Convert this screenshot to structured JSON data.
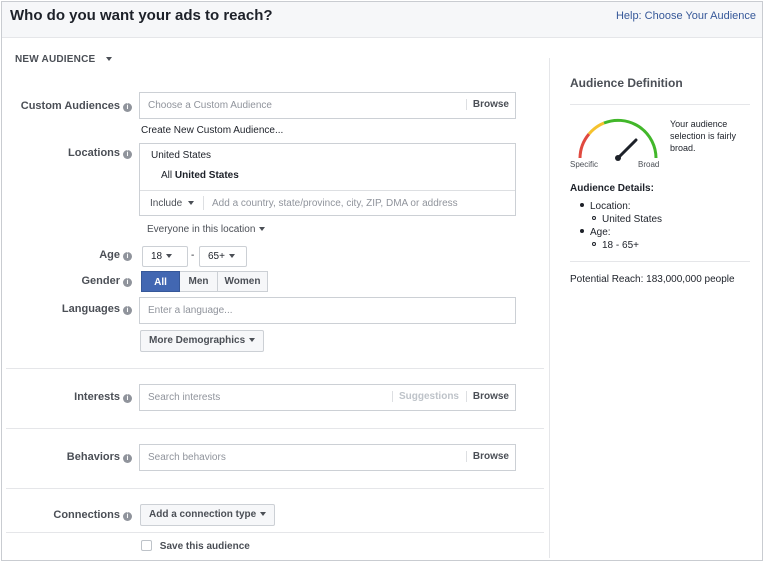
{
  "header": {
    "title": "Who do you want your ads to reach?",
    "help": "Help: Choose Your Audience"
  },
  "new_audience": "NEW AUDIENCE",
  "custom_audiences": {
    "label": "Custom Audiences",
    "placeholder": "Choose a Custom Audience",
    "browse": "Browse",
    "create_link": "Create New Custom Audience..."
  },
  "locations": {
    "label": "Locations",
    "country": "United States",
    "all_prefix": "All",
    "all_value": "United States",
    "include": "Include",
    "placeholder": "Add a country, state/province, city, ZIP, DMA or address",
    "everyone": "Everyone in this location"
  },
  "age": {
    "label": "Age",
    "min": "18",
    "dash": "-",
    "max": "65+"
  },
  "gender": {
    "label": "Gender",
    "options": [
      "All",
      "Men",
      "Women"
    ],
    "selected": "All"
  },
  "languages": {
    "label": "Languages",
    "placeholder": "Enter a language..."
  },
  "more_demographics": "More Demographics",
  "interests": {
    "label": "Interests",
    "placeholder": "Search interests",
    "suggestions": "Suggestions",
    "browse": "Browse"
  },
  "behaviors": {
    "label": "Behaviors",
    "placeholder": "Search behaviors",
    "browse": "Browse"
  },
  "connections": {
    "label": "Connections",
    "button": "Add a connection type"
  },
  "save_audience": "Save this audience",
  "audience_definition": {
    "title": "Audience Definition",
    "gauge_specific": "Specific",
    "gauge_broad": "Broad",
    "description": "Your audience selection is fairly broad.",
    "details_title": "Audience Details:",
    "location_label": "Location:",
    "location_value": "United States",
    "age_label": "Age:",
    "age_value": "18 - 65+",
    "potential_reach": "Potential Reach: 183,000,000 people",
    "colors": {
      "red": "#e0493f",
      "yellow": "#f5c22e",
      "green": "#42b72a",
      "needle": "#1d2129"
    }
  }
}
